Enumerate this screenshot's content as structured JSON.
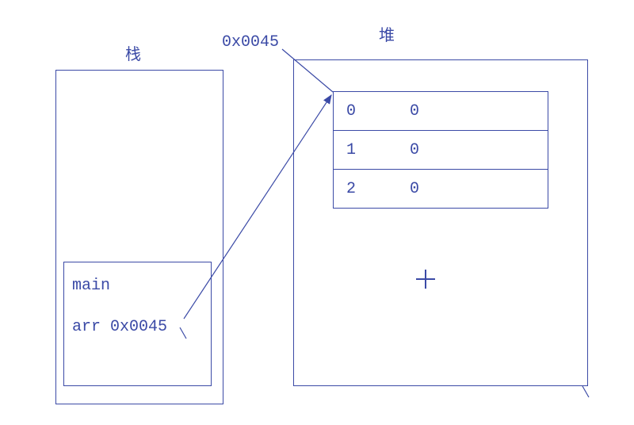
{
  "labels": {
    "stack_title": "栈",
    "heap_title": "堆",
    "address": "0x0045",
    "frame_main": "main",
    "frame_arr": "arr 0x0045"
  },
  "heap_table": [
    {
      "index": "0",
      "value": "0"
    },
    {
      "index": "1",
      "value": "0"
    },
    {
      "index": "2",
      "value": "0"
    }
  ],
  "chart_data": {
    "type": "diagram",
    "title": "",
    "stack": {
      "label": "栈",
      "frames": [
        {
          "name": "main",
          "vars": [
            {
              "name": "arr",
              "value": "0x0045"
            }
          ]
        }
      ]
    },
    "heap": {
      "label": "堆",
      "objects": [
        {
          "address": "0x0045",
          "type": "array",
          "cells": [
            {
              "index": 0,
              "value": 0
            },
            {
              "index": 1,
              "value": 0
            },
            {
              "index": 2,
              "value": 0
            }
          ]
        }
      ]
    },
    "pointers": [
      {
        "from": "stack.main.arr",
        "to": "heap.0x0045"
      }
    ]
  }
}
